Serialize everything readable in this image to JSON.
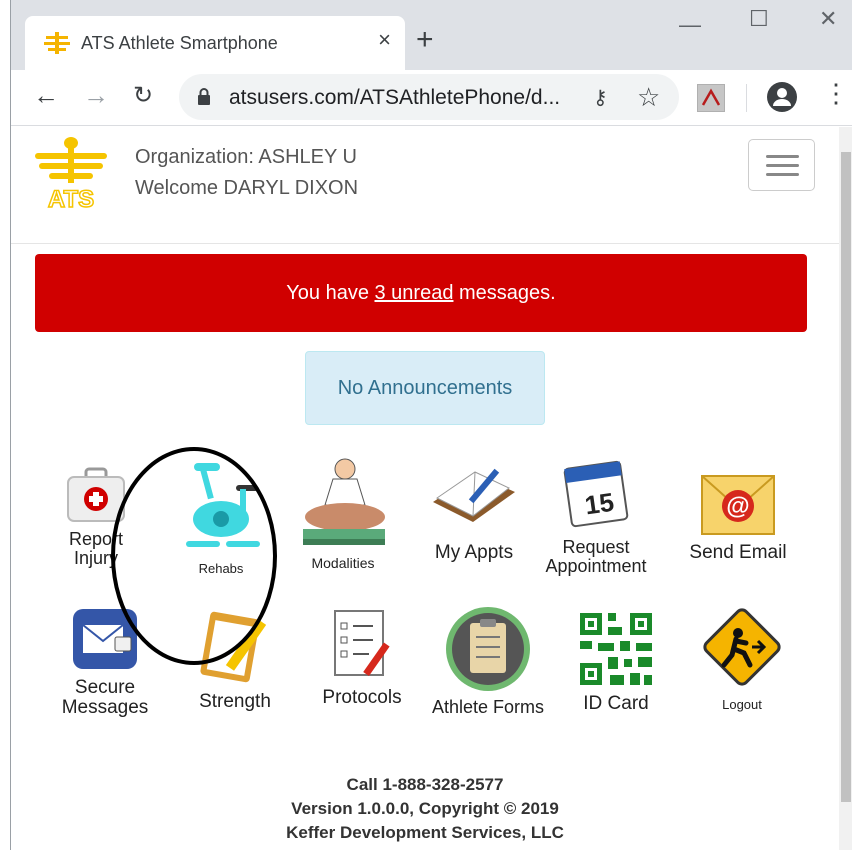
{
  "browser": {
    "tab_title": "ATS Athlete Smartphone",
    "tab_close": "×",
    "new_tab": "+",
    "url": "atsusers.com/ATSAthletePhone/d...",
    "win_minimize": "—",
    "win_maximize": "☐",
    "win_close": "✕"
  },
  "header": {
    "organization": "Organization: ASHLEY U",
    "welcome": "Welcome DARYL DIXON"
  },
  "alert": {
    "prefix": "You have ",
    "link": "3 unread",
    "suffix": " messages.",
    "color": "#d00000"
  },
  "announcement": "No Announcements",
  "tiles": [
    {
      "label": "Report Injury",
      "icon": "first-aid-kit-icon"
    },
    {
      "label": "Rehabs",
      "icon": "exercise-bike-icon"
    },
    {
      "label": "Modalities",
      "icon": "massage-therapy-icon"
    },
    {
      "label": "My Appts",
      "icon": "appointment-book-icon"
    },
    {
      "label": "Request Appointment",
      "icon": "calendar-icon",
      "calendar_day": "15"
    },
    {
      "label": "Send Email",
      "icon": "email-envelope-icon",
      "glyph": "@"
    },
    {
      "label": "Secure Messages",
      "icon": "secure-mail-icon"
    },
    {
      "label": "Strength",
      "icon": "clipboard-pencil-icon"
    },
    {
      "label": "Protocols",
      "icon": "checklist-icon"
    },
    {
      "label": "Athlete Forms",
      "icon": "clipboard-form-icon"
    },
    {
      "label": "ID Card",
      "icon": "qr-code-icon"
    },
    {
      "label": "Logout",
      "icon": "exit-sign-icon"
    }
  ],
  "footer": {
    "phone": "Call 1-888-328-2577",
    "version": "Version 1.0.0.0, Copyright © 2019",
    "company": "Keffer Development Services, LLC"
  },
  "colors": {
    "alert_red": "#d00000",
    "announce_bg": "#d9edf7",
    "logo_gold": "#f5c400"
  }
}
